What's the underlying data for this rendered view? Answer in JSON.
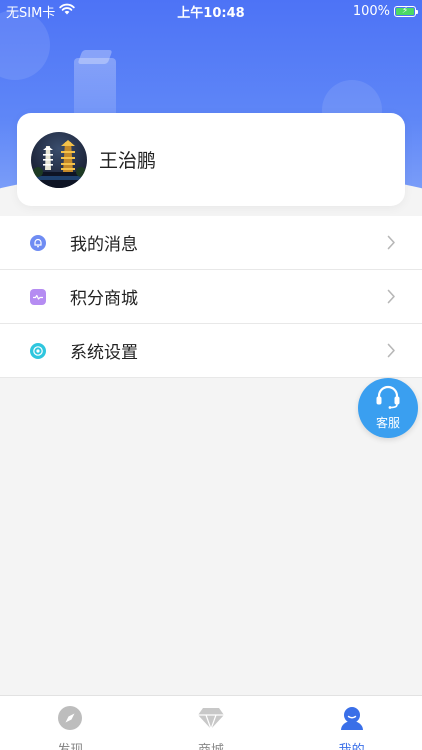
{
  "status_bar": {
    "carrier": "无SIM卡",
    "time": "上午10:48",
    "battery_percent": "100%"
  },
  "profile": {
    "name": "王治鹏",
    "avatar_icon": "pagoda-night-photo"
  },
  "menu": {
    "items": [
      {
        "label": "我的消息",
        "icon": "message-bell-icon",
        "color": "#6f8cf3"
      },
      {
        "label": "积分商城",
        "icon": "points-card-icon",
        "color": "#b58cf2"
      },
      {
        "label": "系统设置",
        "icon": "settings-gear-icon",
        "color": "#2ec6de"
      }
    ]
  },
  "floating": {
    "service_label": "客服",
    "color": "#3a9ff0"
  },
  "tabbar": {
    "tabs": [
      {
        "label": "发现",
        "icon": "compass-icon",
        "active": false
      },
      {
        "label": "商城",
        "icon": "diamond-icon",
        "active": false
      },
      {
        "label": "我的",
        "icon": "user-icon",
        "active": true
      }
    ],
    "active_color": "#3a6fe8",
    "inactive_color": "#888888"
  }
}
